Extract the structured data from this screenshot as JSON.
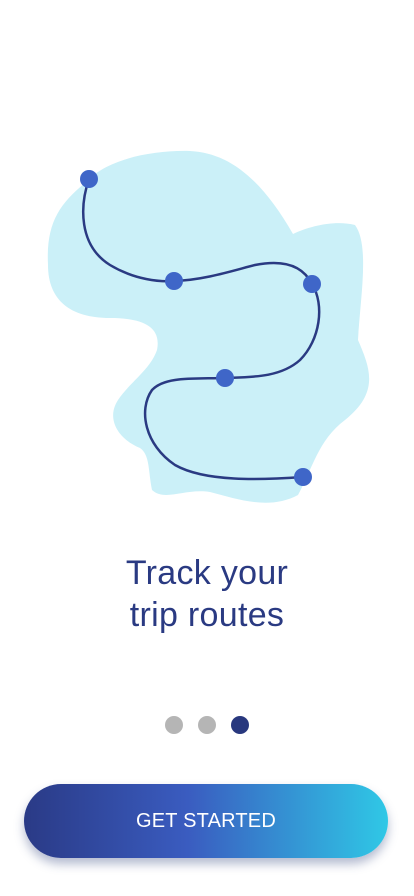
{
  "onboarding": {
    "illustration_icon": "trip-route-map-icon",
    "title_line1": "Track your",
    "title_line2": "trip routes",
    "pager": {
      "total": 3,
      "active_index": 2
    },
    "cta_label": "GET STARTED"
  },
  "colors": {
    "primary": "#2a3a82",
    "blob": "#cbf0f8",
    "route_point": "#3f66c8",
    "dot_inactive": "#b5b5b5",
    "dot_active": "#28387e",
    "button_gradient_start": "#2a3a86",
    "button_gradient_end": "#2fc8e6"
  }
}
